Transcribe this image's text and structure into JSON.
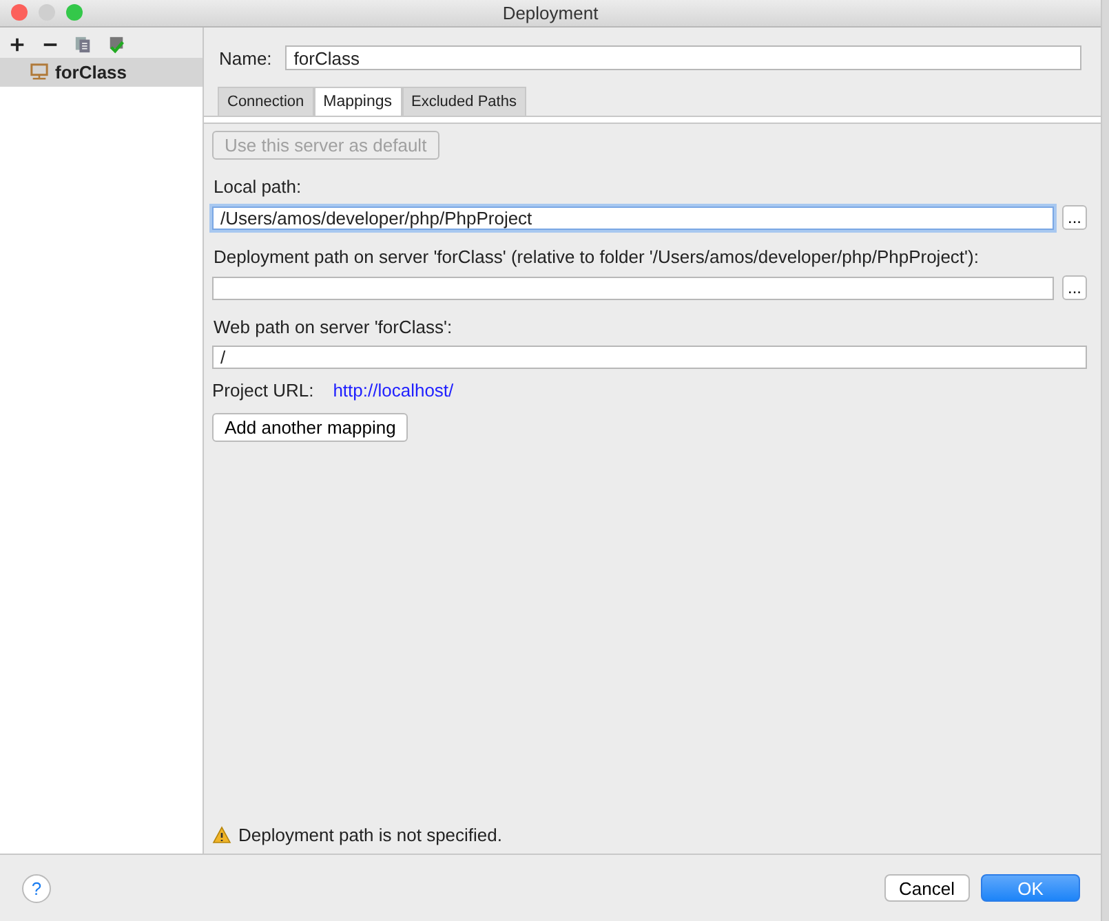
{
  "window": {
    "title": "Deployment"
  },
  "toolbar": [
    {
      "kind": "add"
    },
    {
      "kind": "remove"
    },
    {
      "kind": "copy"
    },
    {
      "kind": "default"
    }
  ],
  "servers": [
    {
      "name": "forClass",
      "selected": true
    }
  ],
  "name_field": {
    "label": "Name:",
    "value": "forClass"
  },
  "tabs": [
    {
      "label": "Connection",
      "selected": false
    },
    {
      "label": "Mappings",
      "selected": true
    },
    {
      "label": "Excluded Paths",
      "selected": false
    }
  ],
  "default_button": {
    "label": "Use this server as default",
    "disabled": true
  },
  "fields": [
    {
      "label": "Local path:",
      "value": "/Users/amos/developer/php/PhpProject",
      "focused": true,
      "browse": "..."
    },
    {
      "label": "Deployment path on server 'forClass' (relative to folder '/Users/amos/developer/php/PhpProject'):",
      "focused": false,
      "browse": "..."
    },
    {
      "label": "Web path on server 'forClass':",
      "value": "/",
      "focused": false
    }
  ],
  "project_url": {
    "label": "Project URL:",
    "link": "http://localhost/"
  },
  "add_mapping_button": "Add another mapping",
  "warning": "Deployment path is not specified.",
  "help_button": "?",
  "buttons": [
    {
      "label": "Cancel",
      "kind": "secondary"
    },
    {
      "label": "OK",
      "kind": "primary"
    }
  ]
}
